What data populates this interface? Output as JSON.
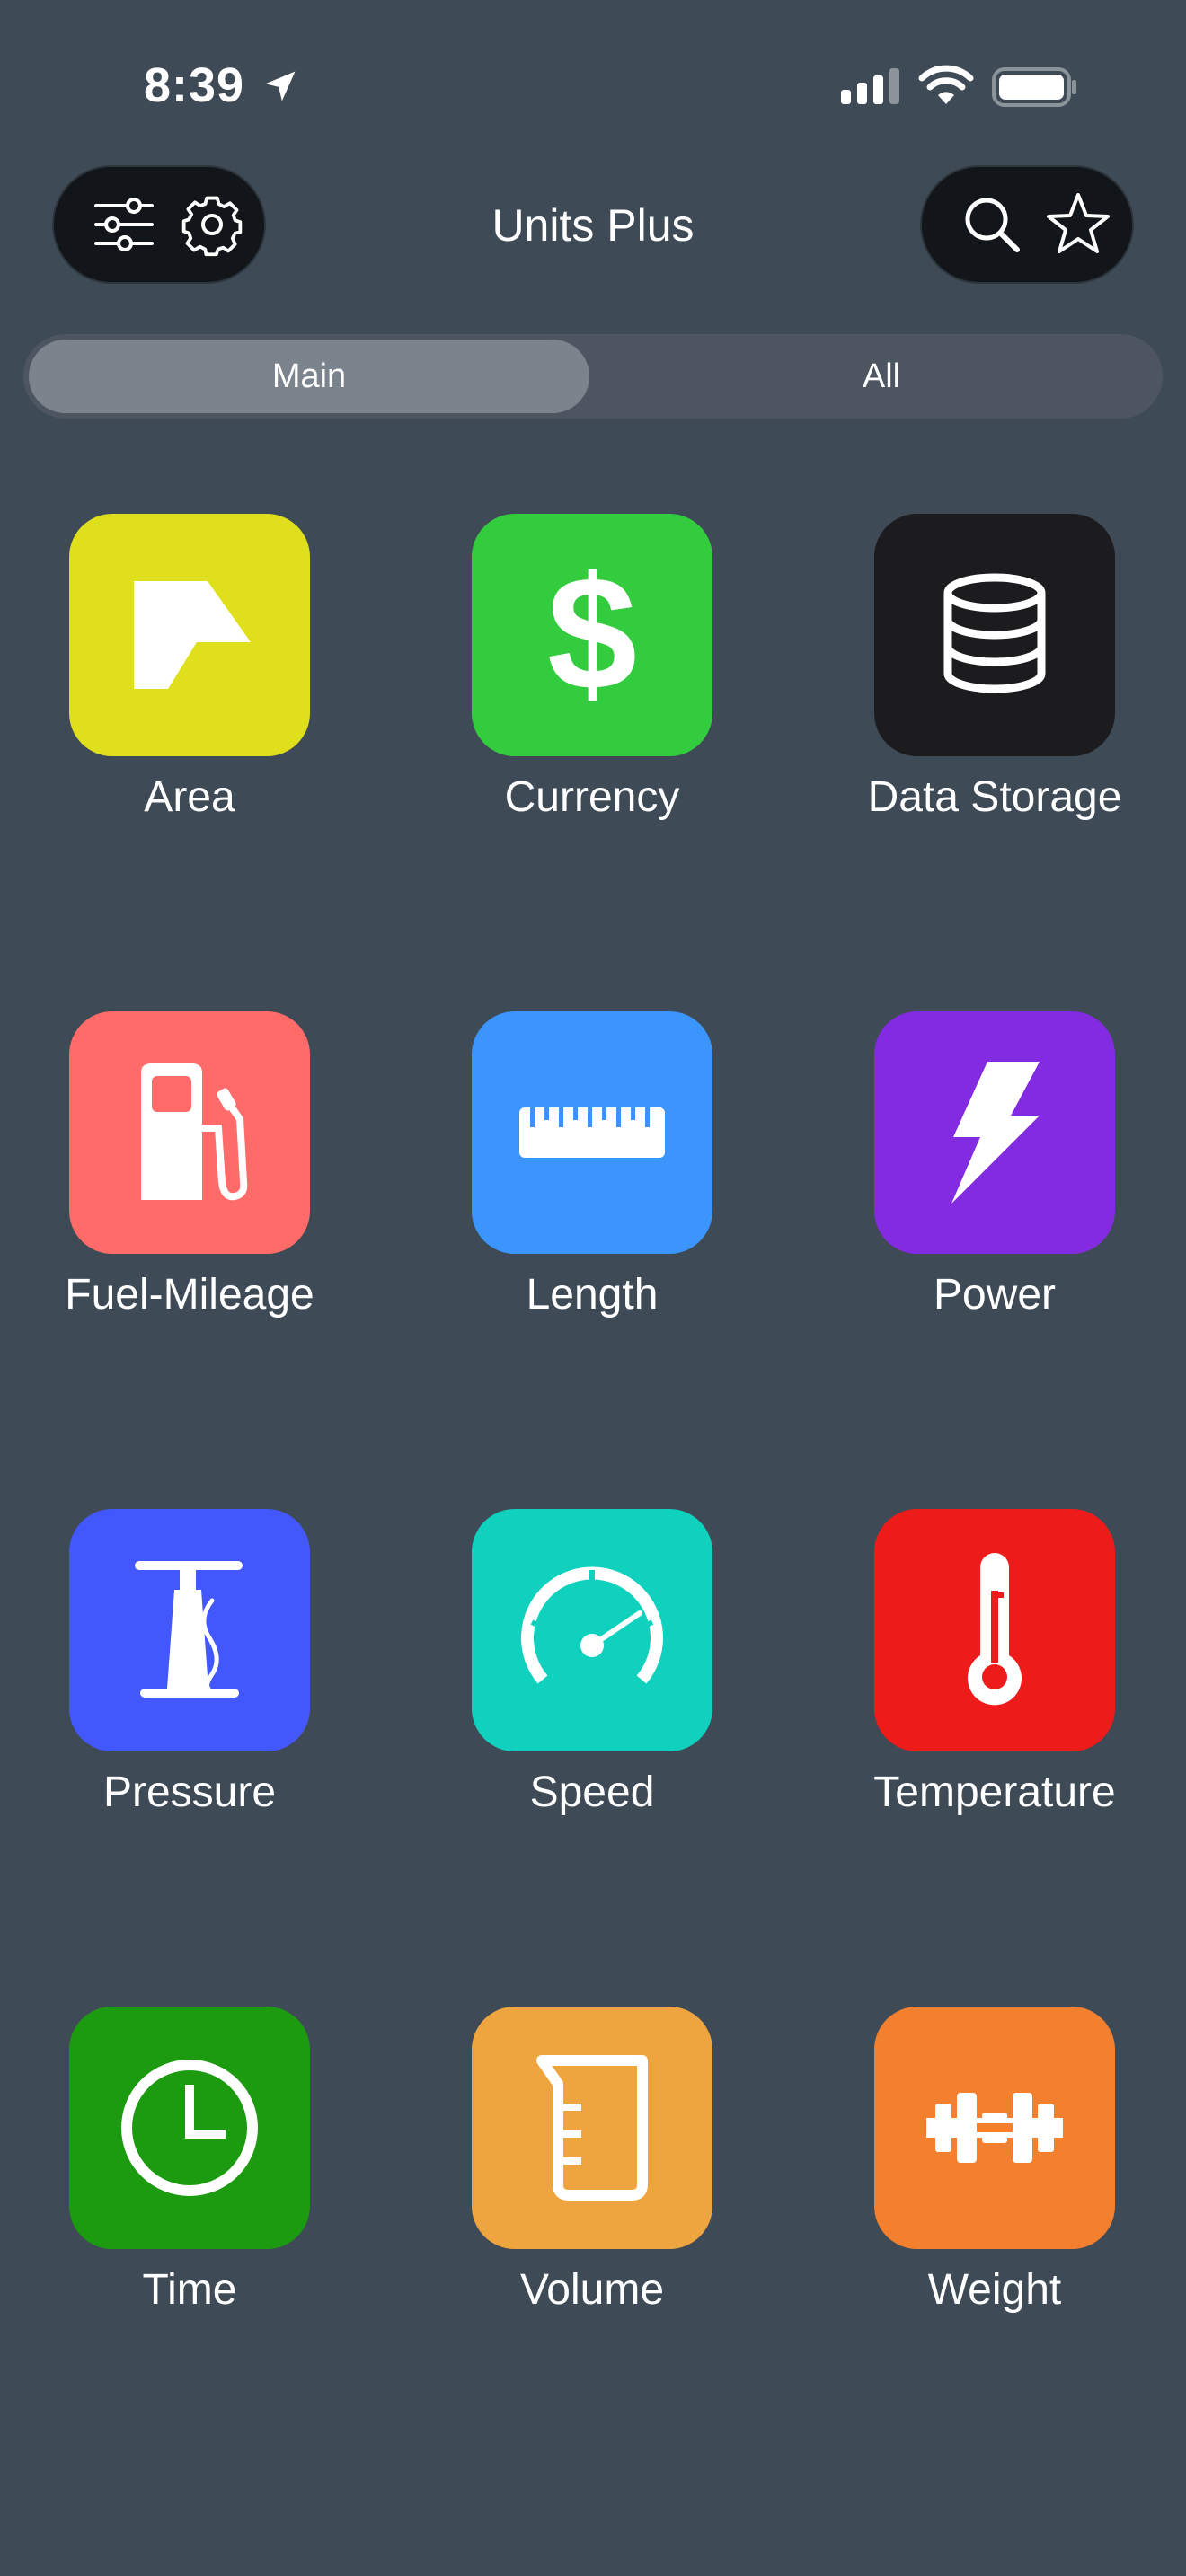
{
  "status_bar": {
    "time": "8:39",
    "icons": [
      "location-arrow-icon",
      "cellular-signal-icon",
      "wifi-icon",
      "battery-icon"
    ]
  },
  "nav": {
    "title": "Units Plus",
    "left_buttons": [
      "sliders-icon",
      "gear-icon"
    ],
    "right_buttons": [
      "search-icon",
      "star-icon"
    ]
  },
  "segments": {
    "main": "Main",
    "all": "All",
    "selected": "Main"
  },
  "categories": [
    {
      "label": "Area",
      "color": "#dfdf1c",
      "icon": "area-shape-icon"
    },
    {
      "label": "Currency",
      "color": "#33cc3f",
      "icon": "dollar-icon"
    },
    {
      "label": "Data Storage",
      "color": "#1c1c1e",
      "icon": "database-icon"
    },
    {
      "label": "Fuel-Mileage",
      "color": "#fe6b68",
      "icon": "fuel-pump-icon"
    },
    {
      "label": "Length",
      "color": "#3b95fc",
      "icon": "ruler-icon"
    },
    {
      "label": "Power",
      "color": "#832be0",
      "icon": "lightning-icon"
    },
    {
      "label": "Pressure",
      "color": "#4358fc",
      "icon": "air-pump-icon"
    },
    {
      "label": "Speed",
      "color": "#10d1bd",
      "icon": "speedometer-icon"
    },
    {
      "label": "Temperature",
      "color": "#ee1b1b",
      "icon": "thermometer-icon"
    },
    {
      "label": "Time",
      "color": "#1c9b10",
      "icon": "clock-icon"
    },
    {
      "label": "Volume",
      "color": "#efa53f",
      "icon": "beaker-icon"
    },
    {
      "label": "Weight",
      "color": "#f3802f",
      "icon": "dumbbell-icon"
    }
  ]
}
